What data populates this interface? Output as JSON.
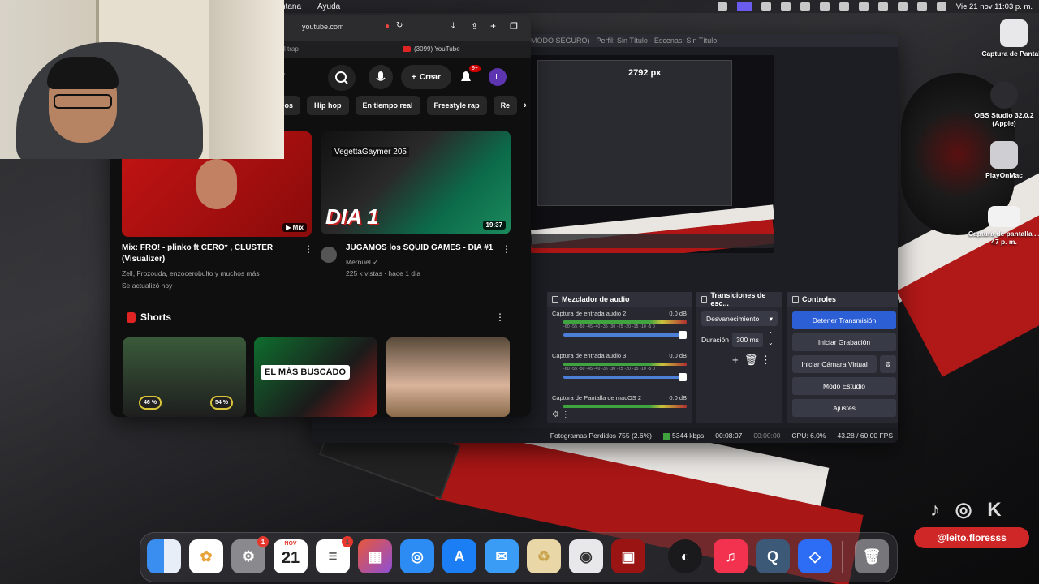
{
  "menubar": {
    "items": [
      "ntana",
      "Ayuda"
    ],
    "clock": "Vie 21 nov  11:03 p. m."
  },
  "desktop_icons": [
    {
      "label": "Captura de Pantalla",
      "icon": "screenshot-app-icon"
    },
    {
      "label": "OBS Studio 32.0.2 (Apple)",
      "icon": "obs-app-icon"
    },
    {
      "label": "PlayOnMac",
      "icon": "disk-icon"
    },
    {
      "label": "Captura de pantalla ... 47 p. m.",
      "icon": "screenshot-file-icon"
    }
  ],
  "browser": {
    "url": "youtube.com",
    "tab_left": "l trap",
    "tab_active": "(3099) YouTube",
    "search_fragment": "r",
    "create_label": "Crear",
    "notif_badge": "9+",
    "avatar_letter": "L",
    "chips": [
      "gos",
      "Hip hop",
      "En tiempo real",
      "Freestyle rap",
      "Re"
    ],
    "videos": [
      {
        "thumb_label": "Mix",
        "title": "Mix: FRO! - plinko ft CERO* , CLUSTER (Visualizer)",
        "meta1": "Zell, Frozouda, enzocerobulto y muchos más",
        "meta2": "Se actualizó hoy"
      },
      {
        "thumb_text": "VegettaGaymer 205",
        "thumb_big": "DIA 1",
        "duration": "19:37",
        "title": "JUGAMOS los SQUID GAMES - DIA #1",
        "channel": "Mernuel",
        "meta": "225 k vistas · hace 1 día"
      }
    ],
    "shorts_title": "Shorts",
    "shorts": [
      {
        "overlay_left": "46 %",
        "overlay_right": "54 %"
      },
      {
        "overlay": "EL MÁS BUSCADO"
      },
      {
        "overlay": ""
      }
    ]
  },
  "obs": {
    "title": "MODO SEGURO) - Perfil: Sin Título - Escenas: Sin Título",
    "preview_label": "2792 px",
    "mixer": {
      "title": "Mezclador de audio",
      "tracks": [
        {
          "name": "Captura de entrada audio 2",
          "db": "0.0 dB"
        },
        {
          "name": "Captura de entrada audio 3",
          "db": "0.0 dB"
        },
        {
          "name": "Captura de Pantalla de macOS 2",
          "db": "0.0 dB"
        }
      ],
      "scale": "-60 -55 -50 -45 -40 -35 -30 -25 -20 -15 -10 -5 0"
    },
    "transitions": {
      "title": "Transiciones de esc...",
      "selected": "Desvanecimiento",
      "duration_label": "Duración",
      "duration_value": "300 ms"
    },
    "controls": {
      "title": "Controles",
      "buttons": [
        "Detener Transmisión",
        "Iniciar Grabación",
        "Iniciar Cámara Virtual",
        "Modo Estudio",
        "Ajustes"
      ]
    },
    "status": {
      "dropped": "Fotogramas Perdidos 755 (2.6%)",
      "kbps": "5344 kbps",
      "stream_time": "00:08:07",
      "rec_time": "00:00:00",
      "cpu": "CPU: 6.0%",
      "fps": "43.28 / 60.00 FPS"
    }
  },
  "dock": {
    "apps": [
      {
        "name": "finder",
        "badge": ""
      },
      {
        "name": "photos",
        "badge": ""
      },
      {
        "name": "settings",
        "badge": "1"
      },
      {
        "name": "calendar",
        "badge": "",
        "month": "NOV",
        "day": "21"
      },
      {
        "name": "reminders",
        "badge": "1"
      },
      {
        "name": "launchpad",
        "badge": ""
      },
      {
        "name": "safari",
        "badge": ""
      },
      {
        "name": "app-store",
        "badge": ""
      },
      {
        "name": "mail",
        "badge": ""
      },
      {
        "name": "recycle",
        "badge": ""
      },
      {
        "name": "screenshot",
        "badge": ""
      },
      {
        "name": "playonmac",
        "badge": ""
      },
      {
        "name": "obs",
        "badge": ""
      },
      {
        "name": "music",
        "badge": ""
      },
      {
        "name": "quicktime",
        "badge": ""
      },
      {
        "name": "roblox",
        "badge": ""
      },
      {
        "name": "trash",
        "badge": ""
      }
    ]
  },
  "watermark": {
    "handle": "@leito.floresss",
    "icons": "♪ ◎ K"
  },
  "colors": {
    "accent_blue": "#2c5ed6",
    "youtube_red": "#e02424",
    "watermark_red": "#cf2727"
  }
}
